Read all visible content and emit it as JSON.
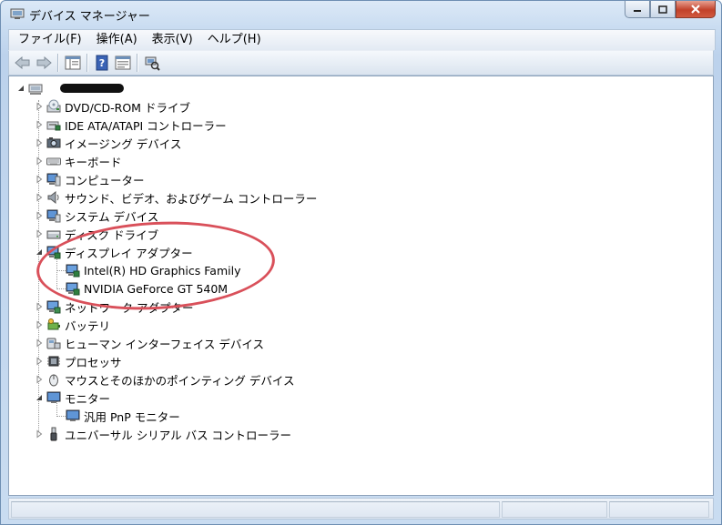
{
  "window": {
    "title": "デバイス マネージャー"
  },
  "menu": [
    "ファイル(F)",
    "操作(A)",
    "表示(V)",
    "ヘルプ(H)"
  ],
  "tree": {
    "root": {
      "label": "",
      "redacted": true
    },
    "categories": [
      {
        "label": "DVD/CD-ROM ドライブ",
        "icon": "dvd-drive-icon",
        "expanded": false,
        "children": []
      },
      {
        "label": "IDE ATA/ATAPI コントローラー",
        "icon": "ide-controller-icon",
        "expanded": false,
        "children": []
      },
      {
        "label": "イメージング デバイス",
        "icon": "camera-icon",
        "expanded": false,
        "children": []
      },
      {
        "label": "キーボード",
        "icon": "keyboard-icon",
        "expanded": false,
        "children": []
      },
      {
        "label": "コンピューター",
        "icon": "computer-icon",
        "expanded": false,
        "children": []
      },
      {
        "label": "サウンド、ビデオ、およびゲーム コントローラー",
        "icon": "speaker-icon",
        "expanded": false,
        "children": []
      },
      {
        "label": "システム デバイス",
        "icon": "system-device-icon",
        "expanded": false,
        "children": []
      },
      {
        "label": "ディスク ドライブ",
        "icon": "disk-drive-icon",
        "expanded": false,
        "children": []
      },
      {
        "label": "ディスプレイ アダプター",
        "icon": "display-adapter-icon",
        "expanded": true,
        "children": [
          "Intel(R) HD Graphics Family",
          "NVIDIA GeForce GT 540M"
        ]
      },
      {
        "label": "ネットワーク アダプター",
        "icon": "network-adapter-icon",
        "expanded": false,
        "children": []
      },
      {
        "label": "バッテリ",
        "icon": "battery-icon",
        "expanded": false,
        "children": []
      },
      {
        "label": "ヒューマン インターフェイス デバイス",
        "icon": "hid-icon",
        "expanded": false,
        "children": []
      },
      {
        "label": "プロセッサ",
        "icon": "processor-icon",
        "expanded": false,
        "children": []
      },
      {
        "label": "マウスとそのほかのポインティング デバイス",
        "icon": "mouse-icon",
        "expanded": false,
        "children": []
      },
      {
        "label": "モニター",
        "icon": "monitor-icon",
        "expanded": true,
        "children": [
          "汎用 PnP モニター"
        ]
      },
      {
        "label": "ユニバーサル シリアル バス コントローラー",
        "icon": "usb-icon",
        "expanded": false,
        "children": []
      }
    ]
  },
  "colors": {
    "highlight_ellipse": "#d9505a",
    "accent": "#1f4fa8"
  }
}
